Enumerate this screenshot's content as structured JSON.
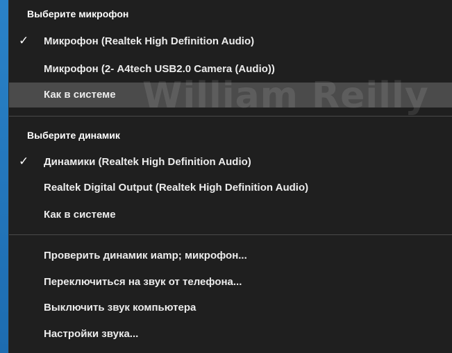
{
  "menu": {
    "microphone_section": {
      "header": "Выберите микрофон",
      "items": [
        {
          "label": "Микрофон (Realtek High Definition Audio)",
          "checked": true
        },
        {
          "label": "Микрофон (2- A4tech USB2.0 Camera (Audio))",
          "checked": false
        },
        {
          "label": "Как в системе",
          "checked": false,
          "highlighted": true
        }
      ]
    },
    "speaker_section": {
      "header": "Выберите динамик",
      "items": [
        {
          "label": "Динамики (Realtek High Definition Audio)",
          "checked": true
        },
        {
          "label": "Realtek Digital Output (Realtek High Definition Audio)",
          "checked": false
        },
        {
          "label": "Как в системе",
          "checked": false
        }
      ]
    },
    "actions": [
      {
        "label": "Проверить динамик иamp; микрофон..."
      },
      {
        "label": "Переключиться на звук от телефона..."
      },
      {
        "label": "Выключить звук компьютера"
      },
      {
        "label": "Настройки звука..."
      }
    ],
    "check_glyph": "✓",
    "watermark": "William Reilly"
  },
  "colors": {
    "menu_background": "#1f1f1f",
    "highlight": "#4b4b4b",
    "separator": "#4a4a4a",
    "text": "#ececec",
    "desktop_blue": "#1a66a8"
  }
}
